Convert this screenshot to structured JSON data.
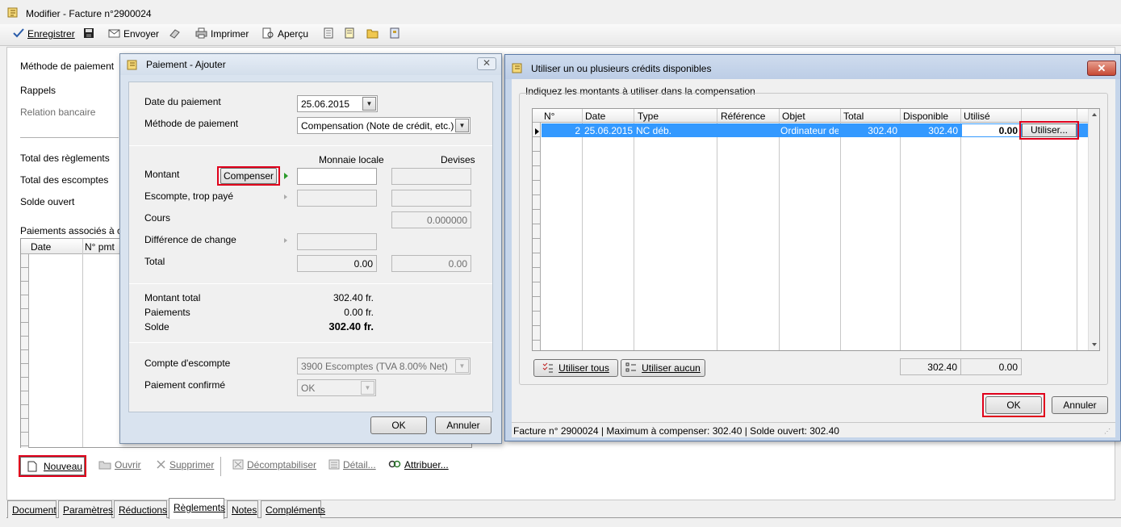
{
  "window": {
    "title": "Modifier - Facture n°2900024"
  },
  "toolbar": {
    "save": "Enregistrer",
    "send": "Envoyer",
    "print": "Imprimer",
    "preview": "Aperçu"
  },
  "main": {
    "labels": {
      "method": "Méthode de paiement",
      "reminders": "Rappels",
      "bank": "Relation bancaire",
      "total_payments": "Total des règlements",
      "total_discounts": "Total des escomptes",
      "open_balance": "Solde ouvert",
      "associated": "Paiements associés à ce d"
    },
    "grid_headers": {
      "date": "Date",
      "num": "N° pmt"
    },
    "actions": {
      "new": "Nouveau",
      "open": "Ouvrir",
      "delete": "Supprimer",
      "unpost": "Décomptabiliser",
      "detail": "Détail...",
      "assign": "Attribuer..."
    },
    "tabs": [
      "Document",
      "Paramètres",
      "Réductions",
      "Règlements",
      "Notes",
      "Compléments"
    ]
  },
  "payment_dialog": {
    "title": "Paiement - Ajouter",
    "date_label": "Date du paiement",
    "date_value": "25.06.2015",
    "method_label": "Méthode de paiement",
    "method_value": "Compensation (Note de crédit, etc.)",
    "col_local": "Monnaie locale",
    "col_foreign": "Devises",
    "amount_label": "Montant",
    "compensate_button": "Compenser",
    "discount_label": "Escompte, trop payé",
    "rate_label": "Cours",
    "rate_value": "0.000000",
    "exchange_diff_label": "Différence de change",
    "total_label": "Total",
    "total_local": "0.00",
    "total_foreign": "0.00",
    "summary": {
      "total_amount_label": "Montant total",
      "total_amount_value": "302.40 fr.",
      "payments_label": "Paiements",
      "payments_value": "0.00 fr.",
      "balance_label": "Solde",
      "balance_value": "302.40 fr."
    },
    "discount_account_label": "Compte d'escompte",
    "discount_account_value": "3900 Escomptes (TVA 8.00% Net)",
    "confirmed_label": "Paiement confirmé",
    "confirmed_value": "OK",
    "ok": "OK",
    "cancel": "Annuler"
  },
  "credits_dialog": {
    "title": "Utiliser un ou plusieurs crédits disponibles",
    "instruction": "Indiquez les montants à utiliser dans la compensation",
    "columns": [
      "N°",
      "Date",
      "Type",
      "Référence",
      "Objet",
      "Total",
      "Disponible",
      "Utilisé"
    ],
    "row": {
      "num": "2",
      "date": "25.06.2015",
      "type": "NC déb.",
      "reference": "",
      "object": "Ordinateur de b",
      "total": "302.40",
      "available": "302.40",
      "used": "0.00",
      "use_button": "Utiliser..."
    },
    "use_all": "Utiliser tous",
    "use_none": "Utiliser aucun",
    "sum_available": "302.40",
    "sum_used": "0.00",
    "ok": "OK",
    "cancel": "Annuler",
    "status": "Facture n° 2900024 | Maximum à compenser: 302.40 | Solde ouvert: 302.40"
  }
}
